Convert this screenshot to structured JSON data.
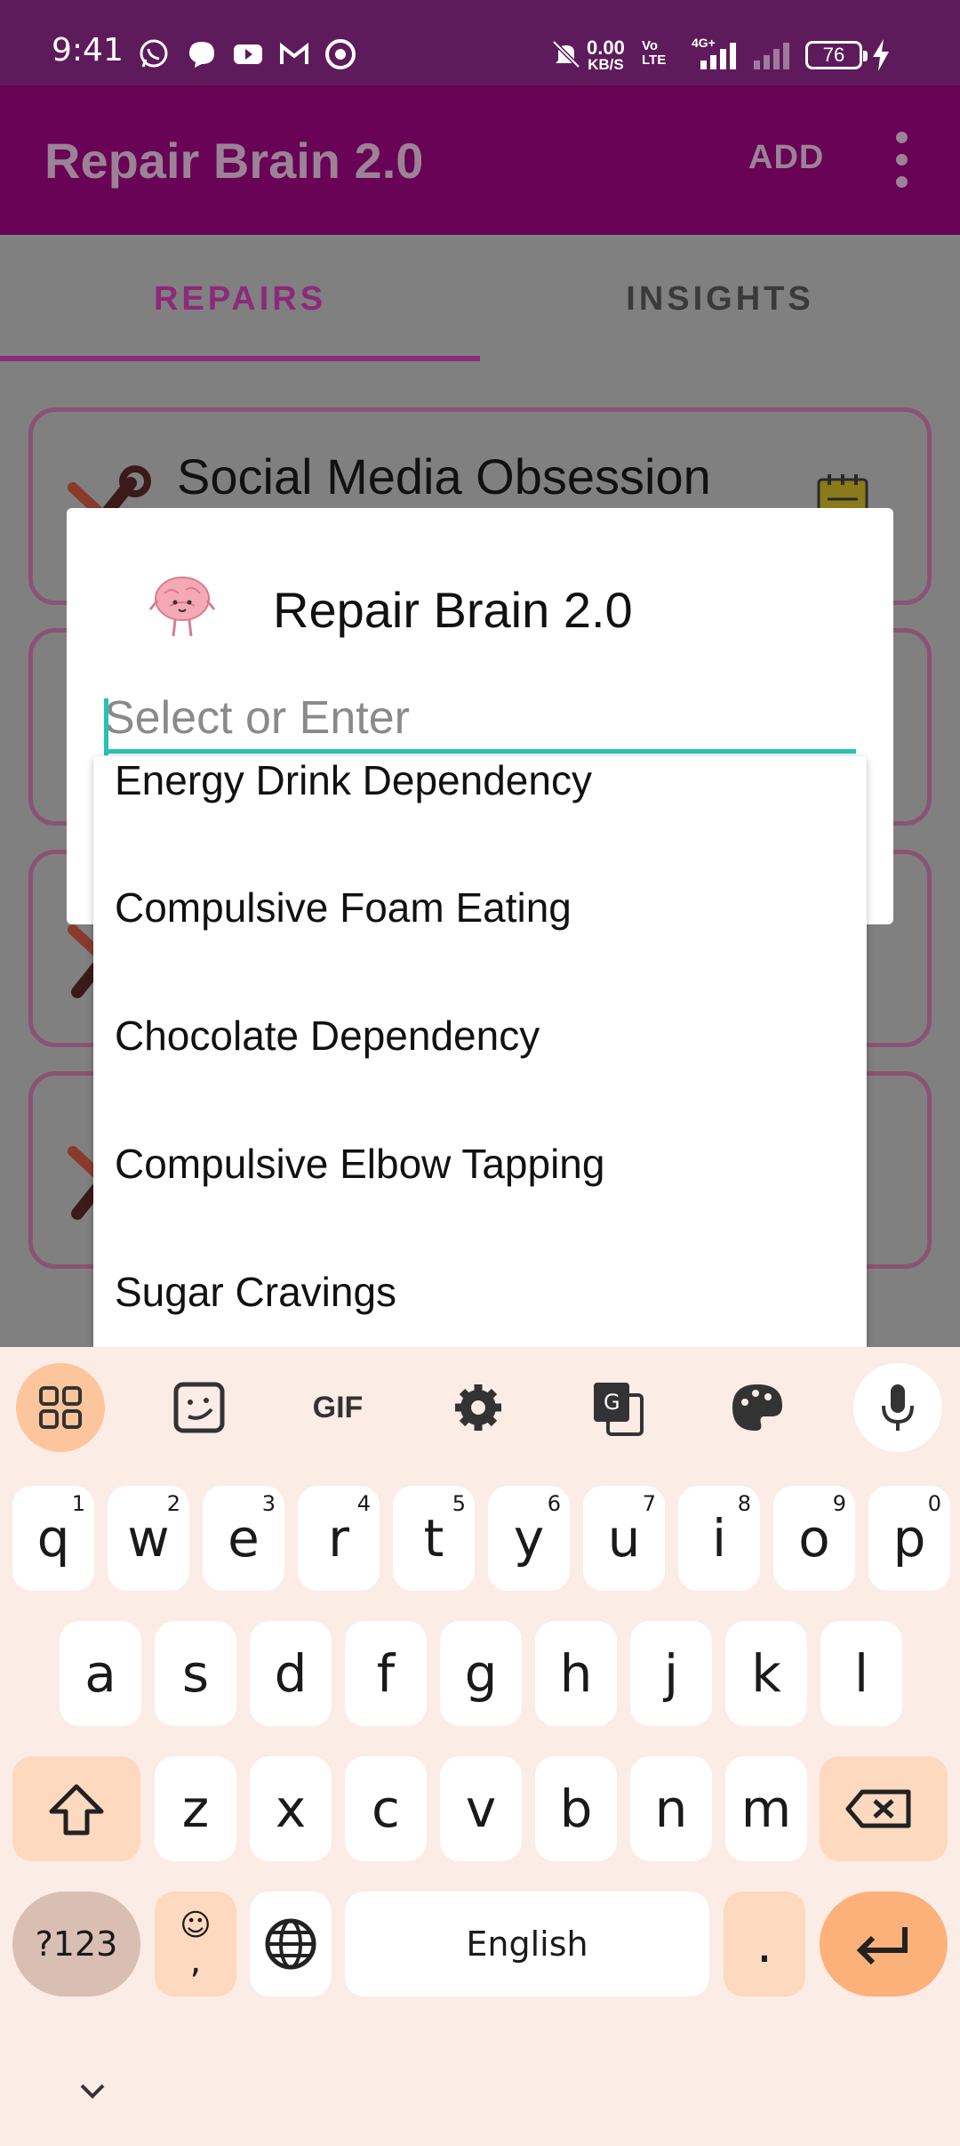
{
  "status_bar": {
    "time": "9:41",
    "net_speed_value": "0.00",
    "net_speed_unit": "KB/S",
    "volte": "Vo LTE",
    "network_4g": "4G+",
    "battery_level": "76"
  },
  "app_bar": {
    "title": "Repair Brain 2.0",
    "add_label": "ADD"
  },
  "tabs": [
    {
      "label": "REPAIRS",
      "selected": true
    },
    {
      "label": "INSIGHTS",
      "selected": false
    }
  ],
  "cards": [
    {
      "title": "Social Media Obsession"
    }
  ],
  "dialog": {
    "title": "Repair Brain 2.0",
    "input_placeholder": "Select or Enter",
    "input_value": ""
  },
  "suggestions": [
    "Energy Drink Dependency",
    "Compulsive Foam Eating",
    "Chocolate Dependency",
    "Compulsive Elbow Tapping",
    "Sugar Cravings"
  ],
  "keyboard": {
    "toolbar": [
      "apps-icon",
      "sticker-icon",
      "GIF",
      "settings-icon",
      "translate-icon",
      "palette-icon",
      "mic-icon"
    ],
    "gif_label": "GIF",
    "row1": [
      {
        "key": "q",
        "hint": "1"
      },
      {
        "key": "w",
        "hint": "2"
      },
      {
        "key": "e",
        "hint": "3"
      },
      {
        "key": "r",
        "hint": "4"
      },
      {
        "key": "t",
        "hint": "5"
      },
      {
        "key": "y",
        "hint": "6"
      },
      {
        "key": "u",
        "hint": "7"
      },
      {
        "key": "i",
        "hint": "8"
      },
      {
        "key": "o",
        "hint": "9"
      },
      {
        "key": "p",
        "hint": "0"
      }
    ],
    "row2": [
      "a",
      "s",
      "d",
      "f",
      "g",
      "h",
      "j",
      "k",
      "l"
    ],
    "row3": [
      "z",
      "x",
      "c",
      "v",
      "b",
      "n",
      "m"
    ],
    "symbols_label": "?123",
    "emoji_comma_label": "☺,",
    "space_label": "English",
    "period_label": ".",
    "accent_color": "#fdb17a"
  },
  "colors": {
    "status_bar": "#5e1b5b",
    "app_bar_dim": "#680355",
    "accent_tab": "#8c2a7a",
    "input_underline": "#27c2b3",
    "keyboard_bg": "#fbece6"
  }
}
